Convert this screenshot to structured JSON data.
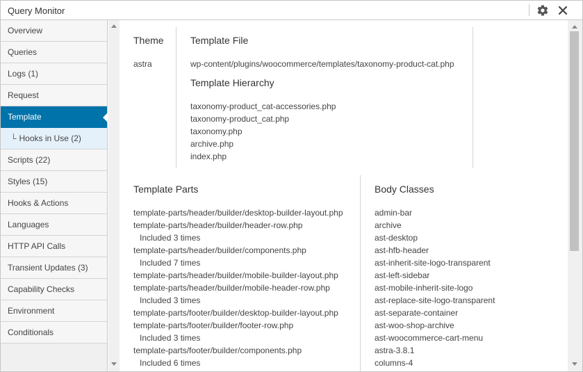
{
  "window": {
    "title": "Query Monitor"
  },
  "sidebar": {
    "items": [
      {
        "label": "Overview"
      },
      {
        "label": "Queries"
      },
      {
        "label": "Logs (1)"
      },
      {
        "label": "Request"
      },
      {
        "label": "Template"
      },
      {
        "label": "Hooks in Use (2)",
        "prefix": "└"
      },
      {
        "label": "Scripts (22)"
      },
      {
        "label": "Styles (15)"
      },
      {
        "label": "Hooks & Actions"
      },
      {
        "label": "Languages"
      },
      {
        "label": "HTTP API Calls"
      },
      {
        "label": "Transient Updates (3)"
      },
      {
        "label": "Capability Checks"
      },
      {
        "label": "Environment"
      },
      {
        "label": "Conditionals"
      }
    ],
    "active": "Template"
  },
  "template": {
    "theme_heading": "Theme",
    "theme_value": "astra",
    "file_heading": "Template File",
    "file_value": "wp-content/plugins/woocommerce/templates/taxonomy-product-cat.php",
    "hierarchy_heading": "Template Hierarchy",
    "hierarchy": [
      "taxonomy-product_cat-accessories.php",
      "taxonomy-product_cat.php",
      "taxonomy.php",
      "archive.php",
      "index.php"
    ],
    "parts_heading": "Template Parts",
    "parts": [
      "template-parts/header/builder/desktop-builder-layout.php",
      "template-parts/header/builder/header-row.php",
      "Included 3 times",
      "template-parts/header/builder/components.php",
      "Included 7 times",
      "template-parts/header/builder/mobile-builder-layout.php",
      "template-parts/header/builder/mobile-header-row.php",
      "Included 3 times",
      "template-parts/footer/builder/desktop-builder-layout.php",
      "template-parts/footer/builder/footer-row.php",
      "Included 3 times",
      "template-parts/footer/builder/components.php",
      "Included 6 times"
    ],
    "body_heading": "Body Classes",
    "body_classes": [
      "admin-bar",
      "archive",
      "ast-desktop",
      "ast-hfb-header",
      "ast-inherit-site-logo-transparent",
      "ast-left-sidebar",
      "ast-mobile-inherit-site-logo",
      "ast-replace-site-logo-transparent",
      "ast-separate-container",
      "ast-woo-shop-archive",
      "ast-woocommerce-cart-menu",
      "astra-3.8.1",
      "columns-4"
    ]
  },
  "colors": {
    "accent": "#0073aa",
    "active_sub_bg": "#e5f1fa"
  },
  "icons": {
    "settings": "gear-icon",
    "close": "close-icon"
  }
}
